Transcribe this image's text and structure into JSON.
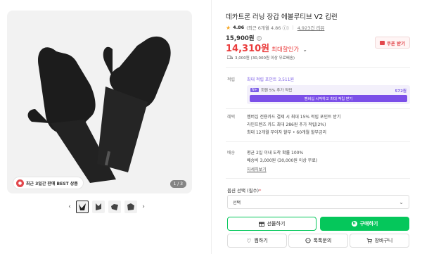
{
  "product": {
    "title": "데카트론 러닝 장갑 에볼루티브 V2 킵런",
    "rating": "4.86",
    "rating_sub": "(최근 6개월 4.86 ⓘ)",
    "reviews": "4,923건 리뷰",
    "original_price": "15,900원",
    "sale_price": "14,310원",
    "sale_label": "최대할인가",
    "coupon_label": "쿠폰 받기",
    "shipping": "3,000원 (30,000원 이상 무료배송)"
  },
  "gallery": {
    "badge": "최근 3일간 판매 BEST 상품",
    "page_indicator": "1 / 3",
    "prev": "‹",
    "next": "›"
  },
  "points": {
    "label": "적립",
    "max_text": "최대 적립 포인트 3,511원",
    "box_tag": "N+",
    "box_text": "회원 5% 추가 적립",
    "box_amount": "572원",
    "box_button": "멤버십 시작하고 최대 적립 받기"
  },
  "benefits": {
    "label": "혜택",
    "lines": [
      "멤버십 전용카드 결제 시 최대 15% 적립 포인트 받기",
      "라인프렌즈 카드 최대 286원 추가 적립(2%)",
      "최대 12개월 무이자 할부 • 60개월 할부금리"
    ]
  },
  "delivery": {
    "label": "배송",
    "line1": "평균 2일 이내 도착 확률 100%",
    "line2": "배송비 3,000원 (30,000원 이상 무료)",
    "link": "자세히보기"
  },
  "option": {
    "label": "옵션 선택 (필수)",
    "required_mark": "*",
    "value": "선택"
  },
  "actions": {
    "gift": "선물하기",
    "buy": "구매하기",
    "buy_icon": "N",
    "wish": "찜하기",
    "talk": "톡톡문의",
    "cart": "장바구니"
  },
  "colors": {
    "sale_red": "#ea3a3a",
    "naver_green": "#05c75b",
    "membership_purple": "#7b4fe8"
  }
}
